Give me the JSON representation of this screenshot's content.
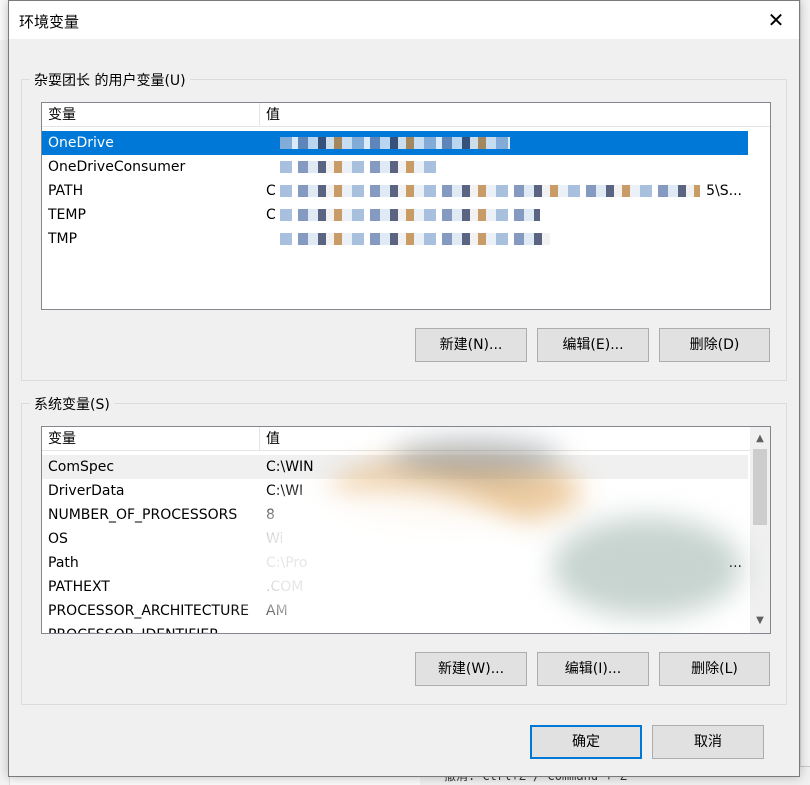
{
  "dialog": {
    "title": "环境变量",
    "close_glyph": "✕"
  },
  "user_vars": {
    "group_label": "杂耍团长 的用户变量(U)",
    "col_name": "变量",
    "col_value": "值",
    "rows": [
      {
        "name": "OneDrive",
        "value": "",
        "selected": true
      },
      {
        "name": "OneDriveConsumer",
        "value": ""
      },
      {
        "name": "PATH",
        "value": "C",
        "suffix": "5\\S..."
      },
      {
        "name": "TEMP",
        "value": "C"
      },
      {
        "name": "TMP",
        "value": ""
      }
    ],
    "buttons": {
      "new": "新建(N)...",
      "edit": "编辑(E)...",
      "delete": "删除(D)"
    }
  },
  "system_vars": {
    "group_label": "系统变量(S)",
    "col_name": "变量",
    "col_value": "值",
    "rows": [
      {
        "name": "ComSpec",
        "value": "C:\\WIN"
      },
      {
        "name": "DriverData",
        "value": "C:\\WI"
      },
      {
        "name": "NUMBER_OF_PROCESSORS",
        "value": "8"
      },
      {
        "name": "OS",
        "value": "Wi"
      },
      {
        "name": "Path",
        "value": "C:\\Pro",
        "suffix": "..."
      },
      {
        "name": "PATHEXT",
        "value": ".COM"
      },
      {
        "name": "PROCESSOR_ARCHITECTURE",
        "value": "AM"
      },
      {
        "name": "PROCESSOR_IDENTIFIER",
        "value": ""
      }
    ],
    "buttons": {
      "new": "新建(W)...",
      "edit": "编辑(I)...",
      "delete": "删除(L)"
    }
  },
  "footer": {
    "ok": "确定",
    "cancel": "取消"
  },
  "background": {
    "bottom_bar_text": "撤消:  Ctrl+Z / Command + Z"
  },
  "colors": {
    "selection": "#0078d7",
    "dialog_bg": "#f0f0f0",
    "default_button_border": "#0078d7"
  }
}
